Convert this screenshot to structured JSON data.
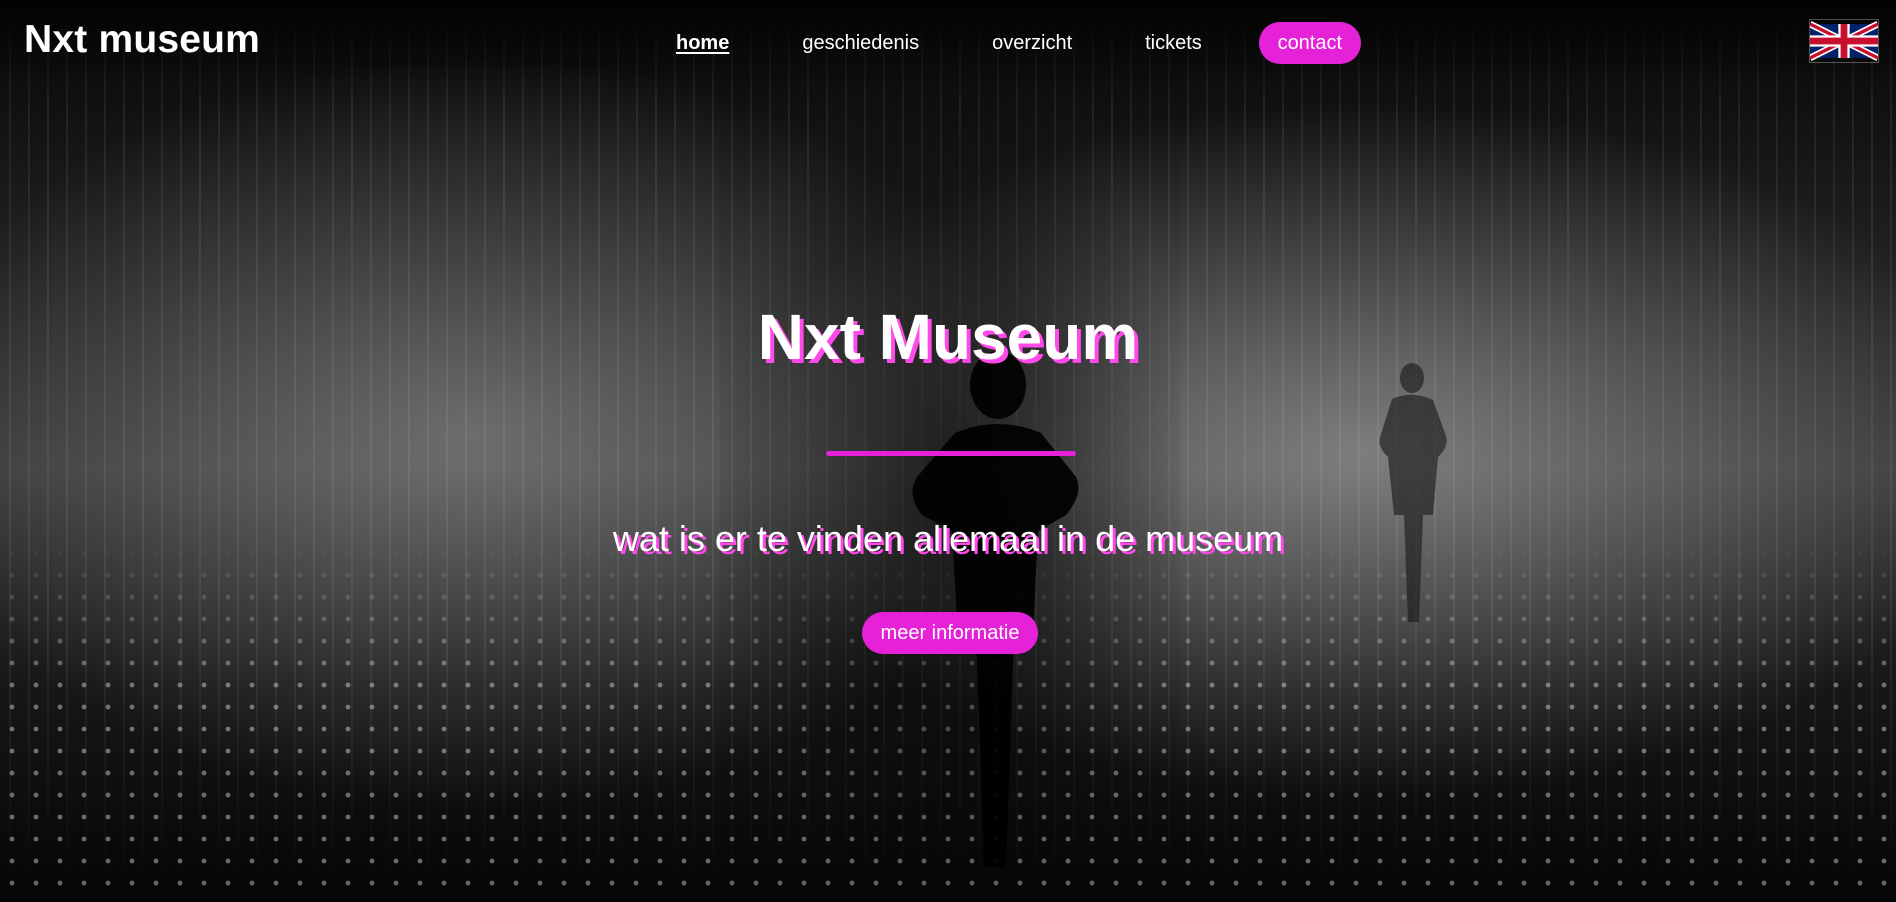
{
  "header": {
    "brand": "Nxt museum",
    "nav": [
      {
        "label": "home"
      },
      {
        "label": "geschiedenis"
      },
      {
        "label": "overzicht"
      },
      {
        "label": "tickets"
      },
      {
        "label": "contact"
      }
    ],
    "language_icon": "uk-flag-icon"
  },
  "hero": {
    "title": "Nxt Museum",
    "subtitle": "wat is er te vinden allemaal in de museum",
    "cta": "meer informatie"
  },
  "colors": {
    "accent": "#e622d8",
    "text": "#ffffff",
    "shadow": "#ff49ea"
  }
}
